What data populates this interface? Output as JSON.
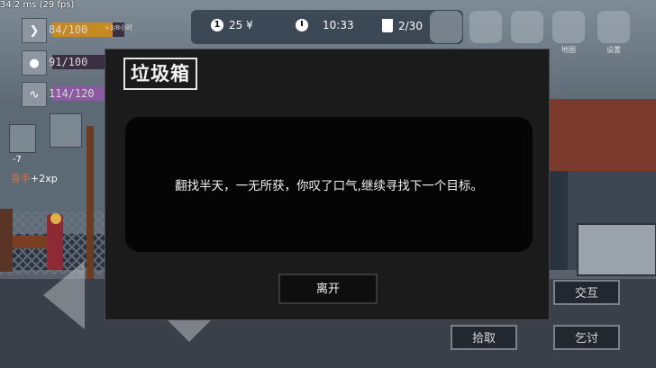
{
  "debug": {
    "fps_text": "34.2 ms (29 fps)"
  },
  "stats": [
    {
      "label": "84/100",
      "icon": "chevron-icon",
      "fraction": 0.84,
      "color": "#c58a22",
      "extra": "+3/8小时"
    },
    {
      "label": "91/100",
      "icon": "water-drop-icon",
      "fraction": 0.91,
      "color": "#3b2f43"
    },
    {
      "label": "114/120",
      "icon": "heartbeat-icon",
      "fraction": 0.95,
      "color": "#8b5aa0"
    }
  ],
  "hunger_icon_value": "-7",
  "hint": {
    "prefix": "身手",
    "suffix": "+2xp"
  },
  "hud": {
    "coins": "25 ¥",
    "coin_glyph": "1",
    "time": "10:33",
    "trash": "2/30"
  },
  "menu": {
    "map_label": "地图",
    "settings_label": "设置"
  },
  "modal": {
    "title": "垃圾箱",
    "message": "翻找半天，一无所获，你叹了口气,继续寻找下一个目标。",
    "leave_label": "离开"
  },
  "actions": {
    "interact": "交互",
    "pickup": "拾取",
    "beg": "乞讨"
  }
}
